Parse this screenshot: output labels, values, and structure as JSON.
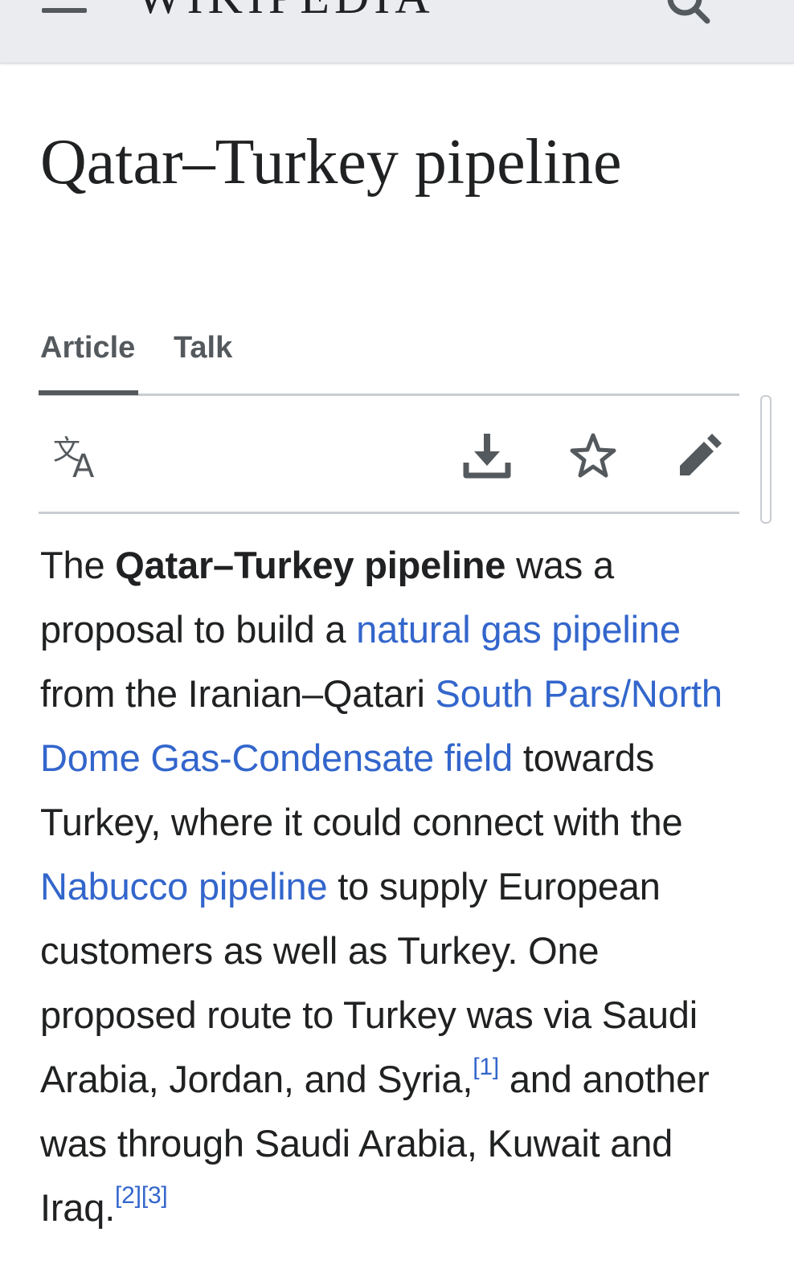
{
  "header": {
    "wordmark": "Wikipedia",
    "menu_icon": "hamburger-menu-icon",
    "search_icon": "search-icon"
  },
  "page": {
    "title": "Qatar–Turkey pipeline"
  },
  "tabs": [
    {
      "label": "Article",
      "selected": true
    },
    {
      "label": "Talk",
      "selected": false
    }
  ],
  "actions": {
    "language": "language-icon",
    "download": "download-icon",
    "watch": "star-icon",
    "edit": "pencil-icon"
  },
  "lead": {
    "t1": "The ",
    "bold_title": "Qatar–Turkey pipeline",
    "t2": " was a proposal to build a ",
    "link_natural_gas": "natural gas pipeline",
    "t3": " from the Iranian–Qatari ",
    "link_south_pars": "South Pars/North Dome Gas-Condensate field",
    "t4": " towards Turkey, where it could connect with the ",
    "link_nabucco": "Nabucco pipeline",
    "t5": " to supply European customers as well as Turkey. One proposed route to Turkey was via Saudi Arabia, Jordan, and Syria,",
    "ref1": "[1]",
    "t6": " and another was through Saudi Arabia, Kuwait and Iraq.",
    "ref2": "[2]",
    "ref3": "[3]"
  },
  "colors": {
    "link": "#3366cc",
    "text": "#202122",
    "header_bg": "#eaecf0",
    "icon": "#54595d"
  }
}
